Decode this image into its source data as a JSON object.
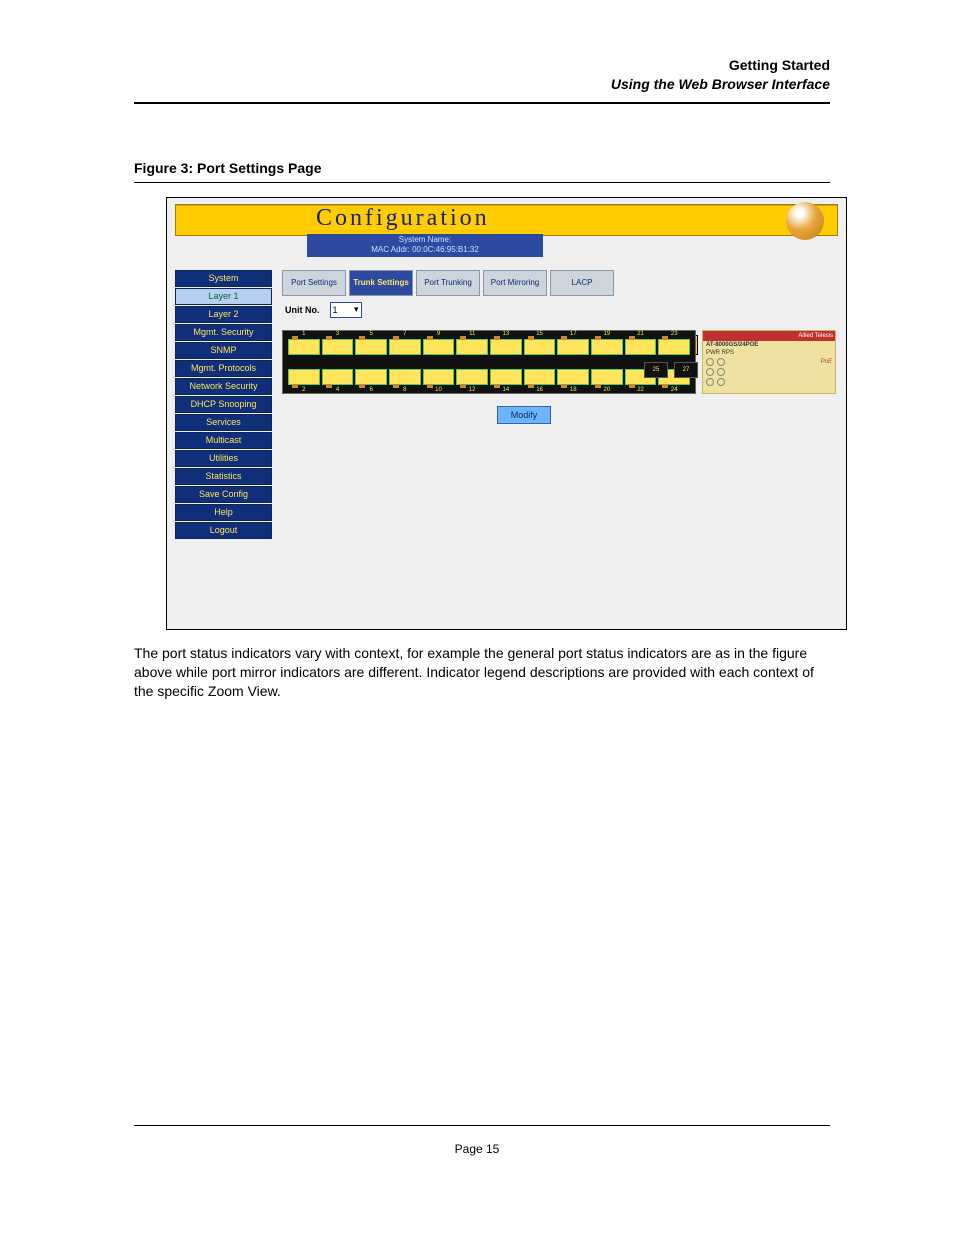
{
  "header": {
    "title": "Getting Started",
    "subtitle": "Using the Web Browser Interface"
  },
  "figure": {
    "caption": "Figure 3:    Port Settings Page"
  },
  "shot": {
    "config_word": "Configuration",
    "sysname_lbl": "System Name:",
    "mac_lbl": "MAC Addr: 00:0C:46:95:B1:32",
    "sidebar": [
      "System",
      "Layer 1",
      "Layer 2",
      "Mgmt. Security",
      "SNMP",
      "Mgmt. Protocols",
      "Network Security",
      "DHCP Snooping",
      "Services",
      "Multicast",
      "Utilities",
      "Statistics",
      "Save Config",
      "Help",
      "Logout"
    ],
    "tabs": [
      "Port Settings",
      "Trunk Settings",
      "Port Trunking",
      "Port Mirroring",
      "LACP"
    ],
    "active_tab": 1,
    "unit_label": "Unit No.",
    "unit_value": "1",
    "port_top": [
      "1",
      "3",
      "5",
      "7",
      "9",
      "11",
      "13",
      "15",
      "17",
      "19",
      "21",
      "23"
    ],
    "port_bot": [
      "2",
      "4",
      "6",
      "8",
      "10",
      "12",
      "14",
      "16",
      "18",
      "20",
      "22",
      "24"
    ],
    "sfp": [
      "25",
      "27"
    ],
    "brand": "Allied Telesis",
    "model": "AT-8000GS/24POE",
    "poe": "PoE",
    "modify": "Modify"
  },
  "body": {
    "p1": "The port status indicators vary with context, for example the general port status indicators are as in the figure above while port mirror indicators are different. Indicator legend descriptions are provided with each context of the specific Zoom View."
  },
  "footer": {
    "page": "Page 15"
  }
}
